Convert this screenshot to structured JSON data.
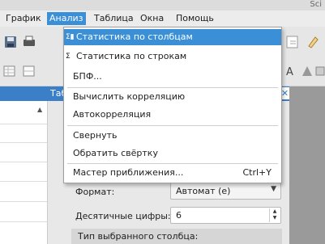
{
  "window": {
    "title_fragment": "Sci"
  },
  "menubar": [
    {
      "label": "График"
    },
    {
      "label": "Анализ"
    },
    {
      "label": "Таблица"
    },
    {
      "label": "Окна"
    },
    {
      "label": "Помощь"
    }
  ],
  "panel": {
    "header_label": "Таб"
  },
  "dialog": {
    "format_label": "Формат:",
    "format_value": "Автомат (e)",
    "decimals_label": "Десятичные цифры:",
    "decimals_value": "6",
    "column_type_label": "Тип выбранного столбца:"
  },
  "menu": {
    "items": [
      {
        "label": "Статистика по столбцам",
        "icon": "column-stats-icon",
        "highlighted": true
      },
      {
        "label": "Статистика по строкам",
        "icon": "row-stats-icon"
      },
      {
        "label": "БПФ..."
      },
      {
        "label": "Вычислить корреляцию"
      },
      {
        "label": "Автокорреляция"
      },
      {
        "label": "Свернуть"
      },
      {
        "label": "Обратить свёртку"
      },
      {
        "label": "Мастер приближения...",
        "shortcut": "Ctrl+Y"
      }
    ]
  },
  "colors": {
    "accent": "#3a8fd6",
    "panel_header": "#3a7fc8"
  }
}
